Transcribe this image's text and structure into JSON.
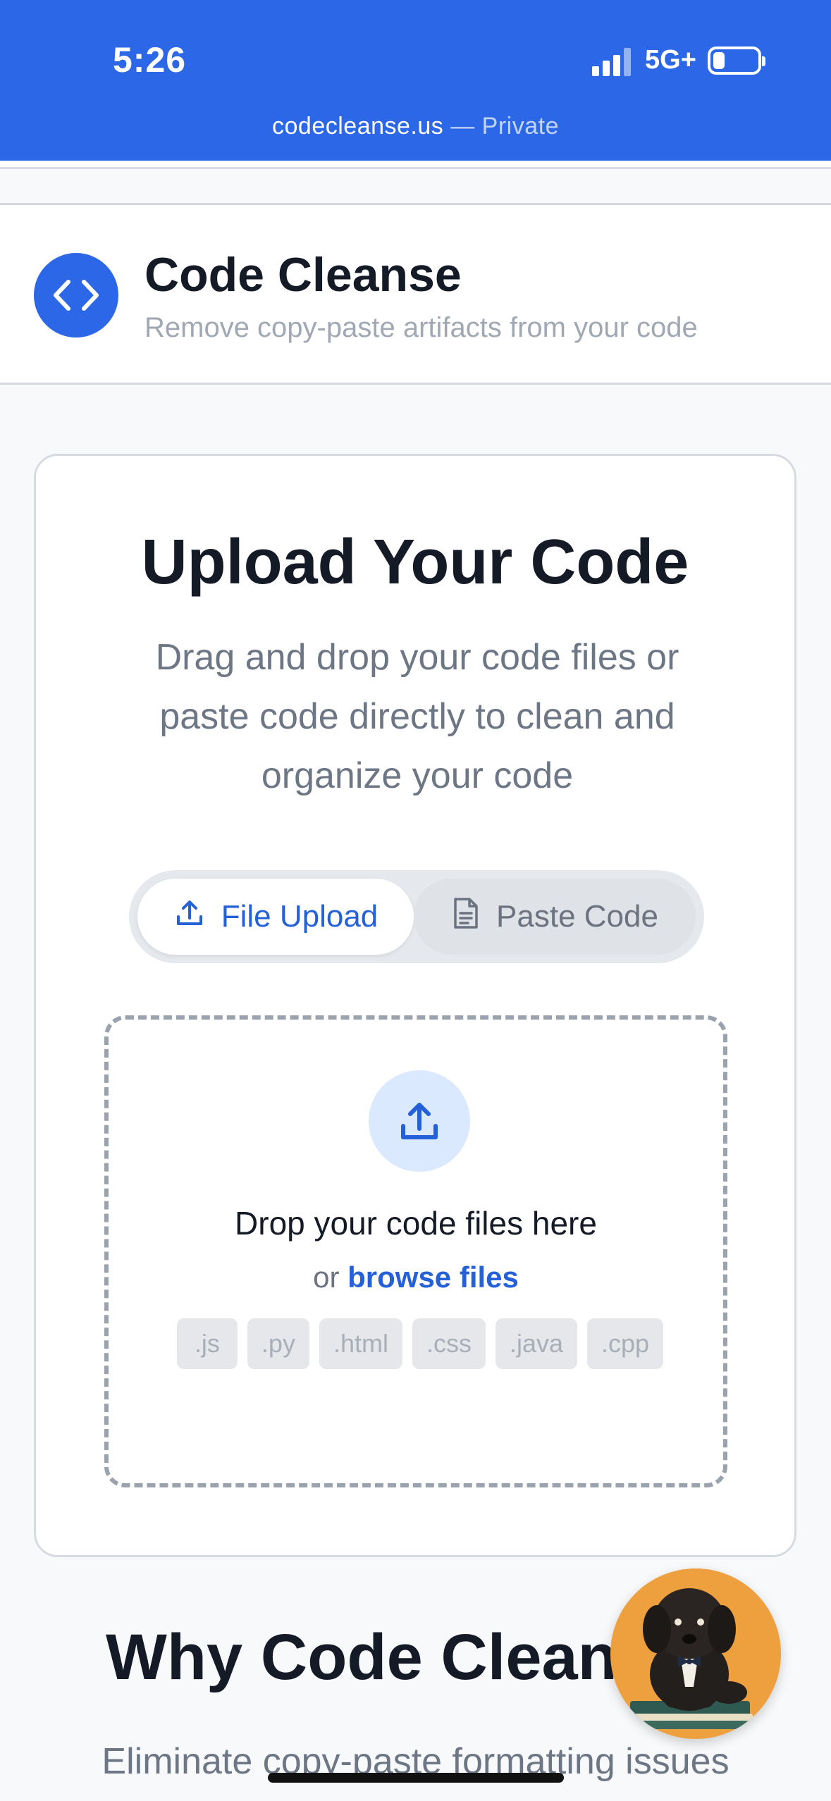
{
  "status_bar": {
    "time": "5:26",
    "network": "5G+",
    "url": "codecleanse.us",
    "url_suffix": " — Private",
    "icons": [
      "signal-icon",
      "battery-icon"
    ]
  },
  "header": {
    "title": "Code Cleanse",
    "subtitle": "Remove copy-paste artifacts from your code",
    "logo_icon": "code-brackets-icon"
  },
  "upload_card": {
    "title": "Upload Your Code",
    "description": "Drag and drop your code files or paste code directly to clean and organize your code",
    "tabs": [
      {
        "label": "File Upload",
        "icon": "upload-icon",
        "active": true
      },
      {
        "label": "Paste Code",
        "icon": "document-icon",
        "active": false
      }
    ],
    "dropzone": {
      "title": "Drop your code files here",
      "or_text": "or ",
      "browse_label": "browse files",
      "extensions": [
        ".js",
        ".py",
        ".html",
        ".css",
        ".java",
        ".cpp"
      ]
    }
  },
  "why_section": {
    "title": "Why Code Clean",
    "description": "Eliminate copy-paste formatting issues"
  },
  "colors": {
    "brand_blue": "#2b67e6",
    "link_blue": "#2460d8",
    "muted_text": "#6d7684",
    "mascot_bg": "#eea03e"
  }
}
